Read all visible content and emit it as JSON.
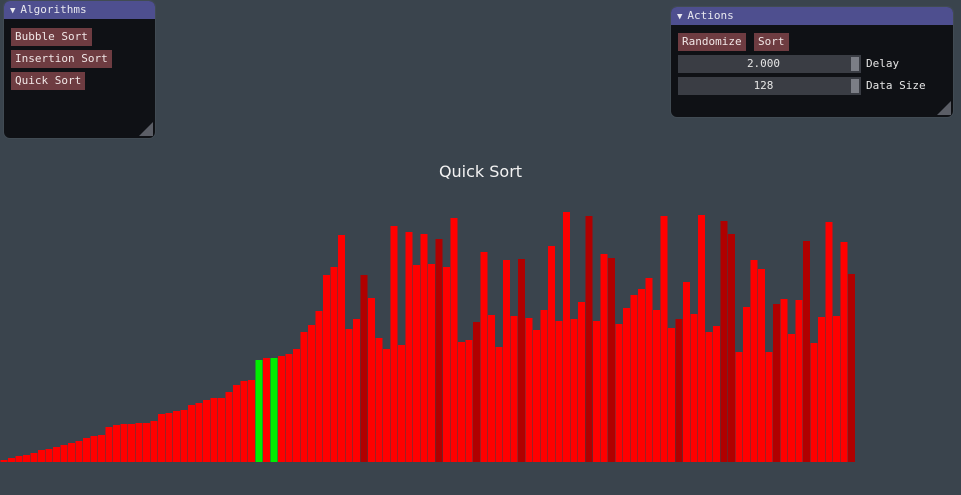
{
  "algorithms_panel": {
    "title": "Algorithms",
    "buttons": [
      "Bubble Sort",
      "Insertion Sort",
      "Quick Sort"
    ]
  },
  "actions_panel": {
    "title": "Actions",
    "randomize_label": "Randomize",
    "sort_label": "Sort",
    "delay": {
      "value": "2.000",
      "label": "Delay"
    },
    "data_size": {
      "value": "128",
      "label": "Data Size"
    }
  },
  "visualization": {
    "title": "Quick Sort",
    "bars": [
      {
        "v": 2,
        "c": "r"
      },
      {
        "v": 4,
        "c": "r"
      },
      {
        "v": 6,
        "c": "r"
      },
      {
        "v": 7,
        "c": "r"
      },
      {
        "v": 9,
        "c": "r"
      },
      {
        "v": 12,
        "c": "r"
      },
      {
        "v": 13,
        "c": "r"
      },
      {
        "v": 15,
        "c": "r"
      },
      {
        "v": 17,
        "c": "r"
      },
      {
        "v": 19,
        "c": "r"
      },
      {
        "v": 21,
        "c": "r"
      },
      {
        "v": 24,
        "c": "r"
      },
      {
        "v": 26,
        "c": "r"
      },
      {
        "v": 27,
        "c": "r"
      },
      {
        "v": 35,
        "c": "r"
      },
      {
        "v": 37,
        "c": "r"
      },
      {
        "v": 38,
        "c": "r"
      },
      {
        "v": 38,
        "c": "r"
      },
      {
        "v": 39,
        "c": "r"
      },
      {
        "v": 39,
        "c": "r"
      },
      {
        "v": 41,
        "c": "r"
      },
      {
        "v": 48,
        "c": "r"
      },
      {
        "v": 49,
        "c": "r"
      },
      {
        "v": 51,
        "c": "r"
      },
      {
        "v": 52,
        "c": "r"
      },
      {
        "v": 57,
        "c": "r"
      },
      {
        "v": 59,
        "c": "r"
      },
      {
        "v": 62,
        "c": "r"
      },
      {
        "v": 64,
        "c": "r"
      },
      {
        "v": 64,
        "c": "r"
      },
      {
        "v": 70,
        "c": "r"
      },
      {
        "v": 77,
        "c": "r"
      },
      {
        "v": 81,
        "c": "r"
      },
      {
        "v": 82,
        "c": "r"
      },
      {
        "v": 102,
        "c": "g"
      },
      {
        "v": 104,
        "c": "r"
      },
      {
        "v": 104,
        "c": "g"
      },
      {
        "v": 106,
        "c": "r"
      },
      {
        "v": 108,
        "c": "r"
      },
      {
        "v": 113,
        "c": "r"
      },
      {
        "v": 130,
        "c": "r"
      },
      {
        "v": 137,
        "c": "r"
      },
      {
        "v": 151,
        "c": "r"
      },
      {
        "v": 187,
        "c": "r"
      },
      {
        "v": 195,
        "c": "r"
      },
      {
        "v": 227,
        "c": "r"
      },
      {
        "v": 133,
        "c": "r"
      },
      {
        "v": 143,
        "c": "r"
      },
      {
        "v": 187,
        "c": "d"
      },
      {
        "v": 164,
        "c": "r"
      },
      {
        "v": 124,
        "c": "r"
      },
      {
        "v": 113,
        "c": "r"
      },
      {
        "v": 236,
        "c": "r"
      },
      {
        "v": 117,
        "c": "r"
      },
      {
        "v": 230,
        "c": "r"
      },
      {
        "v": 197,
        "c": "r"
      },
      {
        "v": 228,
        "c": "r"
      },
      {
        "v": 198,
        "c": "r"
      },
      {
        "v": 223,
        "c": "d"
      },
      {
        "v": 195,
        "c": "r"
      },
      {
        "v": 244,
        "c": "r"
      },
      {
        "v": 120,
        "c": "r"
      },
      {
        "v": 122,
        "c": "r"
      },
      {
        "v": 140,
        "c": "d"
      },
      {
        "v": 210,
        "c": "r"
      },
      {
        "v": 147,
        "c": "r"
      },
      {
        "v": 115,
        "c": "r"
      },
      {
        "v": 202,
        "c": "r"
      },
      {
        "v": 146,
        "c": "r"
      },
      {
        "v": 203,
        "c": "d"
      },
      {
        "v": 144,
        "c": "r"
      },
      {
        "v": 132,
        "c": "r"
      },
      {
        "v": 152,
        "c": "r"
      },
      {
        "v": 216,
        "c": "r"
      },
      {
        "v": 141,
        "c": "r"
      },
      {
        "v": 250,
        "c": "r"
      },
      {
        "v": 143,
        "c": "r"
      },
      {
        "v": 160,
        "c": "r"
      },
      {
        "v": 246,
        "c": "d"
      },
      {
        "v": 141,
        "c": "r"
      },
      {
        "v": 208,
        "c": "r"
      },
      {
        "v": 204,
        "c": "d"
      },
      {
        "v": 138,
        "c": "r"
      },
      {
        "v": 154,
        "c": "r"
      },
      {
        "v": 167,
        "c": "r"
      },
      {
        "v": 173,
        "c": "r"
      },
      {
        "v": 184,
        "c": "r"
      },
      {
        "v": 152,
        "c": "r"
      },
      {
        "v": 246,
        "c": "r"
      },
      {
        "v": 134,
        "c": "r"
      },
      {
        "v": 143,
        "c": "d"
      },
      {
        "v": 180,
        "c": "r"
      },
      {
        "v": 148,
        "c": "r"
      },
      {
        "v": 247,
        "c": "r"
      },
      {
        "v": 130,
        "c": "r"
      },
      {
        "v": 136,
        "c": "r"
      },
      {
        "v": 241,
        "c": "d"
      },
      {
        "v": 228,
        "c": "d"
      },
      {
        "v": 110,
        "c": "r"
      },
      {
        "v": 155,
        "c": "r"
      },
      {
        "v": 202,
        "c": "r"
      },
      {
        "v": 193,
        "c": "r"
      },
      {
        "v": 110,
        "c": "r"
      },
      {
        "v": 158,
        "c": "d"
      },
      {
        "v": 163,
        "c": "r"
      },
      {
        "v": 128,
        "c": "r"
      },
      {
        "v": 162,
        "c": "r"
      },
      {
        "v": 221,
        "c": "d"
      },
      {
        "v": 119,
        "c": "r"
      },
      {
        "v": 145,
        "c": "r"
      },
      {
        "v": 240,
        "c": "r"
      },
      {
        "v": 146,
        "c": "r"
      },
      {
        "v": 220,
        "c": "r"
      },
      {
        "v": 188,
        "c": "d"
      }
    ]
  },
  "colors": {
    "background": "#3a444d",
    "bar_red": "#ff0000",
    "bar_dark_red": "#b00000",
    "bar_green": "#00ee00",
    "panel_title": "#4e4f8f",
    "button": "#6e3c41"
  },
  "icons": {
    "collapse": "triangle-down-icon",
    "resize": "resize-grip-icon"
  }
}
